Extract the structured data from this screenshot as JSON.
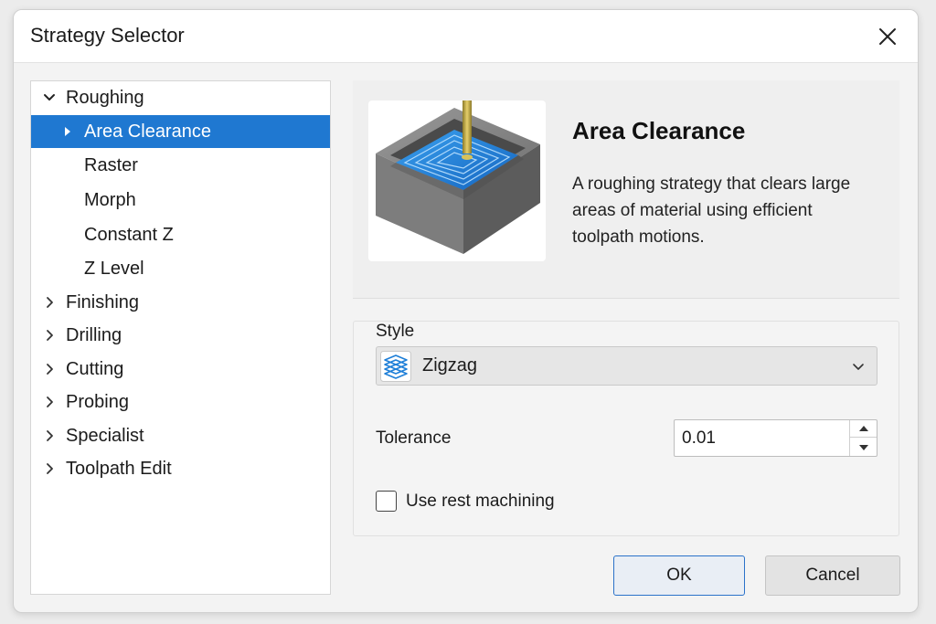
{
  "window": {
    "title": "Strategy Selector"
  },
  "tree": {
    "items": [
      {
        "label": "Roughing",
        "level": 0,
        "expanded": true
      },
      {
        "label": "Area Clearance",
        "level": 1,
        "selected": true
      },
      {
        "label": "Raster",
        "level": 1
      },
      {
        "label": "Morph",
        "level": 1
      },
      {
        "label": "Constant Z",
        "level": 1
      },
      {
        "label": "Z Level",
        "level": 1
      },
      {
        "label": "Finishing",
        "level": 0,
        "expanded": false
      },
      {
        "label": "Drilling",
        "level": 0,
        "expanded": false
      },
      {
        "label": "Cutting",
        "level": 0,
        "expanded": false
      },
      {
        "label": "Probing",
        "level": 0,
        "expanded": false
      },
      {
        "label": "Specialist",
        "level": 0,
        "expanded": false
      },
      {
        "label": "Toolpath Edit",
        "level": 0,
        "expanded": false
      }
    ]
  },
  "details": {
    "title": "Area Clearance",
    "description": "A roughing strategy that clears large areas of material using efficient toolpath motions."
  },
  "options": {
    "style_label": "Style",
    "style_value": "Zigzag",
    "tolerance_label": "Tolerance",
    "tolerance_value": "0.01",
    "rest_machining_label": "Use rest machining",
    "rest_machining_checked": false
  },
  "buttons": {
    "ok": "OK",
    "cancel": "Cancel"
  },
  "colors": {
    "selection": "#1f78d1",
    "accent": "#2a72c9"
  }
}
